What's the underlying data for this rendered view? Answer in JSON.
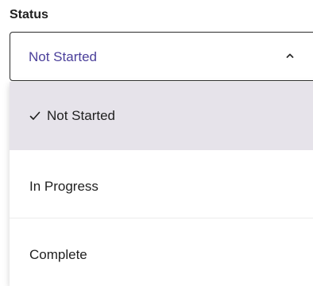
{
  "field": {
    "label": "Status",
    "selected_value": "Not Started"
  },
  "options": [
    {
      "label": "Not Started",
      "selected": true
    },
    {
      "label": "In Progress",
      "selected": false
    },
    {
      "label": "Complete",
      "selected": false
    }
  ],
  "icons": {
    "chevron": "chevron-up-icon",
    "check": "checkmark-icon"
  },
  "colors": {
    "selected_value_text": "#4a3f9a",
    "selected_option_bg": "#e6e3ea",
    "border": "#2b2b2b"
  }
}
